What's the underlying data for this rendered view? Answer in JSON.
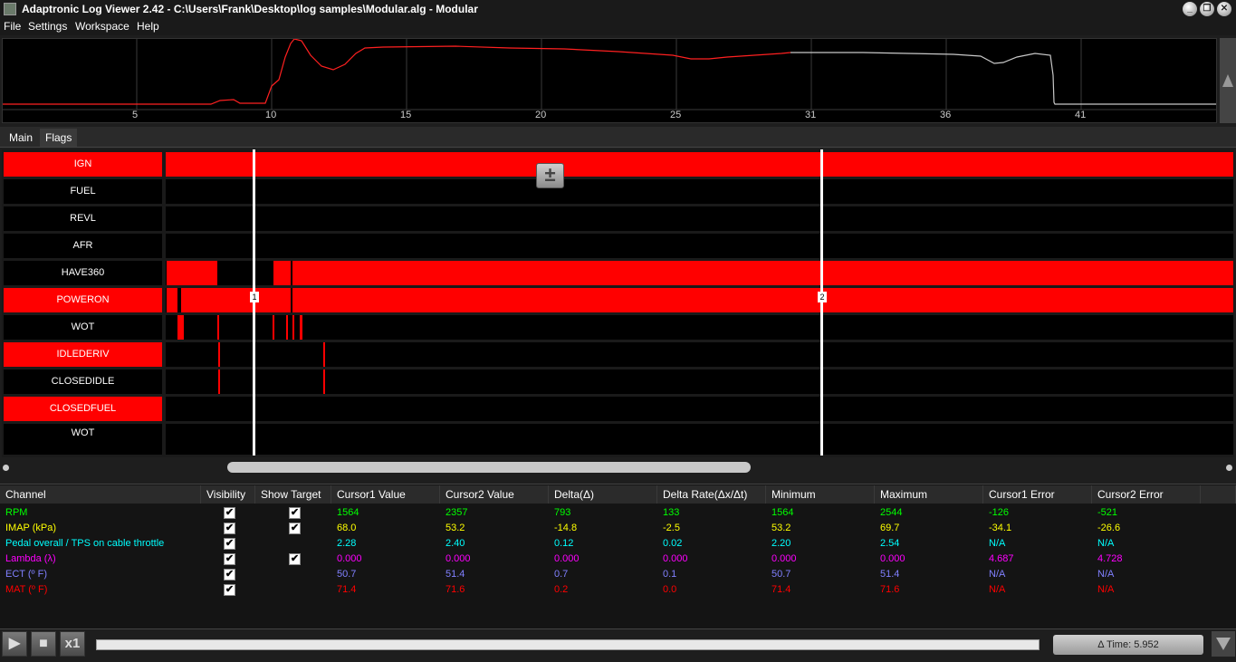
{
  "window": {
    "title": "Adaptronic Log Viewer 2.42 - C:\\Users\\Frank\\Desktop\\log samples\\Modular.alg - Modular",
    "buttons": [
      "_",
      "❐",
      "✕"
    ]
  },
  "menu": [
    "File",
    "Settings",
    "Workspace",
    "Help"
  ],
  "overview": {
    "ticks": [
      "5",
      "10",
      "15",
      "20",
      "25",
      "31",
      "36",
      "41"
    ]
  },
  "tabs": [
    "Main",
    "Flags"
  ],
  "zoom_button": "±",
  "flags": [
    {
      "name": "IGN",
      "active": true
    },
    {
      "name": "FUEL",
      "active": false
    },
    {
      "name": "REVL",
      "active": false
    },
    {
      "name": "AFR",
      "active": false
    },
    {
      "name": "HAVE360",
      "active": false
    },
    {
      "name": "POWERON",
      "active": true
    },
    {
      "name": "WOT",
      "active": false
    },
    {
      "name": "IDLEDERIV",
      "active": true
    },
    {
      "name": "CLOSEDIDLE",
      "active": false
    },
    {
      "name": "CLOSEDFUEL",
      "active": true
    },
    {
      "name": "WOT",
      "active": false
    }
  ],
  "cursors": {
    "cursor1": "1",
    "cursor2": "2"
  },
  "table": {
    "headers": [
      "Channel",
      "Visibility",
      "Show Target",
      "Cursor1 Value",
      "Cursor2 Value",
      "Delta(Δ)",
      "Delta Rate(Δx/Δt)",
      "Minimum",
      "Maximum",
      "Cursor1 Error",
      "Cursor2 Error"
    ],
    "rows": [
      {
        "channel": "RPM",
        "visible": true,
        "target": true,
        "c1": "1564",
        "c2": "2357",
        "delta": "793",
        "rate": "133",
        "min": "1564",
        "max": "2544",
        "e1": "-126",
        "e2": "-521",
        "color": "#00ff00"
      },
      {
        "channel": "IMAP  (kPa)",
        "visible": true,
        "target": true,
        "c1": "68.0",
        "c2": "53.2",
        "delta": "-14.8",
        "rate": "-2.5",
        "min": "53.2",
        "max": "69.7",
        "e1": "-34.1",
        "e2": "-26.6",
        "color": "#ffff00"
      },
      {
        "channel": "Pedal overall / TPS on cable throttle",
        "visible": true,
        "target": false,
        "c1": "2.28",
        "c2": "2.40",
        "delta": "0.12",
        "rate": "0.02",
        "min": "2.20",
        "max": "2.54",
        "e1": "N/A",
        "e2": "N/A",
        "color": "#00ffff"
      },
      {
        "channel": "Lambda (λ)",
        "visible": true,
        "target": true,
        "c1": "0.000",
        "c2": "0.000",
        "delta": "0.000",
        "rate": "0.000",
        "min": "0.000",
        "max": "0.000",
        "e1": "4.687",
        "e2": "4.728",
        "color": "#ff00ff"
      },
      {
        "channel": "ECT (º F)",
        "visible": true,
        "target": false,
        "c1": "50.7",
        "c2": "51.4",
        "delta": "0.7",
        "rate": "0.1",
        "min": "50.7",
        "max": "51.4",
        "e1": "N/A",
        "e2": "N/A",
        "color": "#8080ff"
      },
      {
        "channel": "MAT (º F)",
        "visible": true,
        "target": false,
        "c1": "71.4",
        "c2": "71.6",
        "delta": "0.2",
        "rate": "0.0",
        "min": "71.4",
        "max": "71.6",
        "e1": "N/A",
        "e2": "N/A",
        "color": "#ff0000"
      }
    ]
  },
  "bottom": {
    "play": "▶",
    "stop": "■",
    "speed": "x1",
    "delta_time": "Δ Time: 5.952"
  }
}
